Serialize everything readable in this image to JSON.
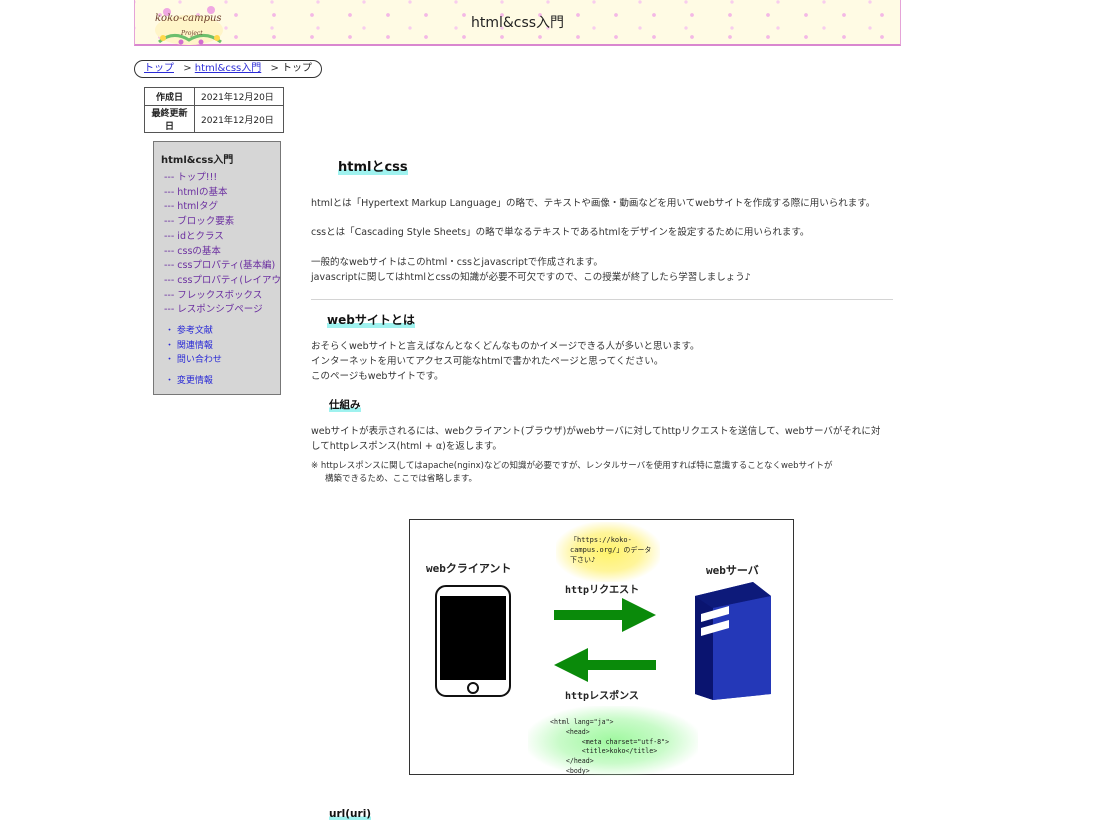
{
  "header": {
    "logo_text": "koko-campus",
    "logo_sub": "Project",
    "site_title": "html&css入門"
  },
  "breadcrumb": {
    "items": [
      {
        "label": "トップ",
        "link": true
      },
      {
        "label": "html&css入門",
        "link": true
      },
      {
        "label": "トップ",
        "link": false
      }
    ],
    "separator": ">"
  },
  "dates": {
    "created_label": "作成日",
    "created_value": "2021年12月20日",
    "updated_label": "最終更新日",
    "updated_value": "2021年12月20日"
  },
  "sidebar": {
    "title": "html&css入門",
    "sub_items": [
      "--- トップ!!!",
      "--- htmlの基本",
      "--- htmlタグ",
      "--- ブロック要素",
      "--- idとクラス",
      "--- cssの基本",
      "--- cssプロパティ(基本編)",
      "--- cssプロパティ(レイアウト編)",
      "--- フレックスボックス",
      "--- レスポンシブページ"
    ],
    "links": [
      "・ 参考文献",
      "・ 関連情報",
      "・ 問い合わせ",
      "・ 変更情報"
    ]
  },
  "main": {
    "h_html_css": "htmlとcss",
    "p1": "htmlとは「Hypertext Markup Language」の略で、テキストや画像・動画などを用いてwebサイトを作成する際に用いられます。",
    "p2": "cssとは「Cascading Style Sheets」の略で単なるテキストであるhtmlをデザインを設定するために用いられます。",
    "p3a": "一般的なwebサイトはこのhtml・cssとjavascriptで作成されます。",
    "p3b": "javascriptに関してはhtmlとcssの知識が必要不可欠ですので、この授業が終了したら学習しましょう♪",
    "h_website": "webサイトとは",
    "p4a": "おそらくwebサイトと言えばなんとなくどんなものかイメージできる人が多いと思います。",
    "p4b": "インターネットを用いてアクセス可能なhtmlで書かれたページと思ってください。",
    "p4c": "このページもwebサイトです。",
    "h_mechanism": "仕組み",
    "p5a": "webサイトが表示されるには、webクライアント(ブラウザ)がwebサーバに対してhttpリクエストを送信して、webサーバがそれに対",
    "p5b": "してhttpレスポンス(html + α)を返します。",
    "note_a": "※  httpレスポンスに関してはapache(nginx)などの知識が必要ですが、レンタルサーバを使用すれば特に意識することなくwebサイトが",
    "note_b": "構築できるため、ここでは省略します。",
    "h_url": "url(uri)"
  },
  "diagram": {
    "client_label": "webクライアント",
    "server_label": "webサーバ",
    "request_label": "httpリクエスト",
    "response_label": "httpレスポンス",
    "request_text": "「https://koko-\ncampus.org/」のデータ\n下さい♪",
    "response_code": "<html lang=\"ja\">\n    <head>\n        <meta charset=\"utf-8\">\n        <title>koko</title>\n    </head>\n    <body>",
    "colors": {
      "arrow": "#0a8a0a",
      "server": "#0a1a8c",
      "highlight": "#9ff2ef"
    }
  }
}
